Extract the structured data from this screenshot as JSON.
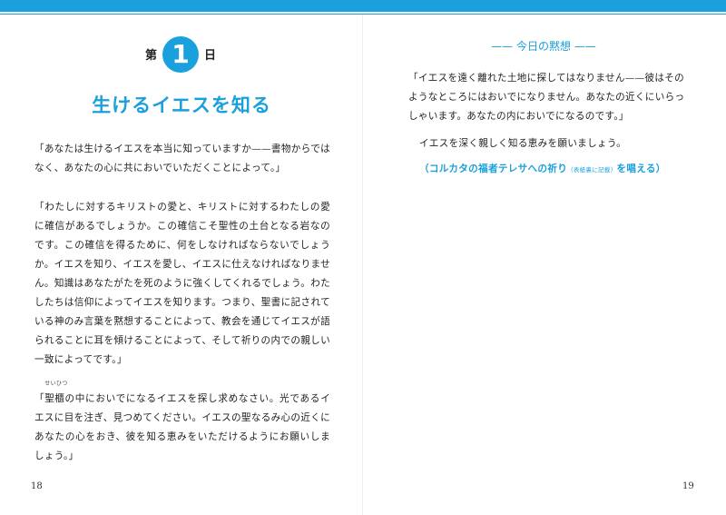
{
  "left_page": {
    "day": {
      "prefix": "第",
      "number": "1",
      "suffix": "日"
    },
    "title": "生けるイエスを知る",
    "paragraphs": [
      "「あなたは生けるイエスを本当に知っていますか——書物からではなく、あなたの心に共においでいただくことによって。」",
      "「わたしに対するキリストの愛と、キリストに対するわたしの愛に確信があるでしょうか。この確信こそ聖性の土台となる岩なのです。この確信を得るために、何をしなければならないでしょうか。イエスを知り、イエスを愛し、イエスに仕えなければなりません。知識はあなたがたを死のように強くしてくれるでしょう。わたしたちは信仰によってイエスを知ります。つまり、聖書に記されている神のみ言葉を黙想することによって、教会を通じてイエスが語られることに耳を傾けることによって、そして祈りの内での親しい一致によってです。」"
    ],
    "third_paragraph": {
      "open": "「",
      "ruby_base": "聖櫃",
      "ruby_text": "せいひつ",
      "rest": "の中においでになるイエスを探し求めなさい。光であるイエスに目を注ぎ、見つめてください。イエスの聖なるみ心の近くにあなたの心をおき、彼を知る恵みをいただけるようにお願いしましょう。」"
    },
    "page_number": "18"
  },
  "right_page": {
    "heading": "—— 今日の黙想 ——",
    "meditation": "「イエスを遠く離れた土地に探してはなりません——彼はそのようなところにはおいでになりません。あなたの近くにいらっしゃいます。あなたの内においでになるのです。」",
    "prayer": "イエスを深く親しく知る恵みを願いましょう。",
    "rosary": {
      "main": "（コルカタの福者テレサへの祈り",
      "note": "（表紙裏に記載）",
      "end": "を唱える）"
    },
    "page_number": "19"
  },
  "colors": {
    "accent": "#1aa0dc",
    "text": "#222222"
  }
}
